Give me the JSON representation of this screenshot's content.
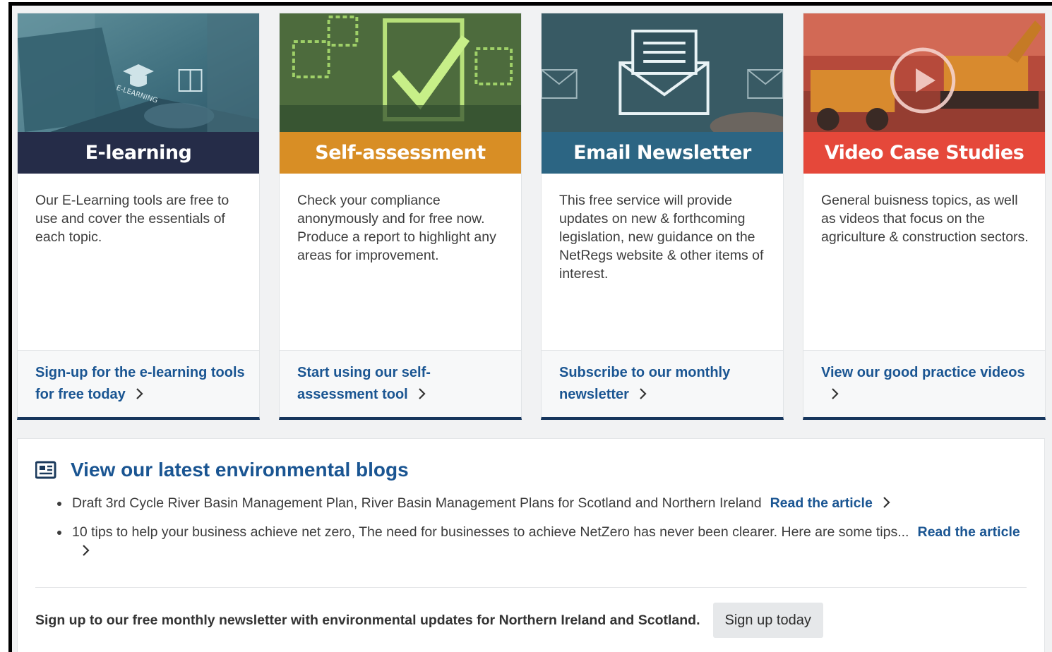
{
  "colors": {
    "elearning_band": "#252c48",
    "selfassessment_band": "#d88e25",
    "newsletter_band": "#2c6583",
    "video_band": "#e5483a",
    "link_blue": "#1a5592",
    "card_border_bottom": "#17365d"
  },
  "cards": [
    {
      "title": "E-learning",
      "image_icon": "laptop-elearning-photo",
      "image_caption": "E-LEARNING",
      "description": "Our E-Learning tools are free to use and cover the essentials of each topic.",
      "link_label": "Sign-up for the e-learning tools for free today"
    },
    {
      "title": "Self-assessment",
      "image_icon": "checkmark-photo",
      "description": "Check your compliance anonymously and for free now. Produce a report to highlight any areas for improvement.",
      "link_label": "Start using our self-assessment tool"
    },
    {
      "title": "Email Newsletter",
      "image_icon": "envelope-photo",
      "description": "This free service will provide updates on new & forthcoming legislation, new guidance on the NetRegs website & other items of interest.",
      "link_label": "Subscribe to our monthly newsletter"
    },
    {
      "title": "Video Case Studies",
      "image_icon": "excavator-play-photo",
      "description": "General buisness topics, as well as videos that focus on the agriculture & construction sectors.",
      "link_label": "View our good practice videos"
    }
  ],
  "blogs": {
    "icon": "newspaper-icon",
    "title": "View our latest environmental blogs",
    "items": [
      {
        "text": "Draft 3rd Cycle River Basin Management Plan, River Basin Management Plans for Scotland and Northern Ireland",
        "link_label": "Read the article"
      },
      {
        "text": "10 tips to help your business achieve net zero, The need for businesses to achieve NetZero has never been clearer. Here are some tips...",
        "link_label": "Read the article"
      }
    ],
    "signup_text": "Sign up to our free monthly newsletter with environmental updates for Northern Ireland and Scotland.",
    "signup_button": "Sign up today"
  }
}
